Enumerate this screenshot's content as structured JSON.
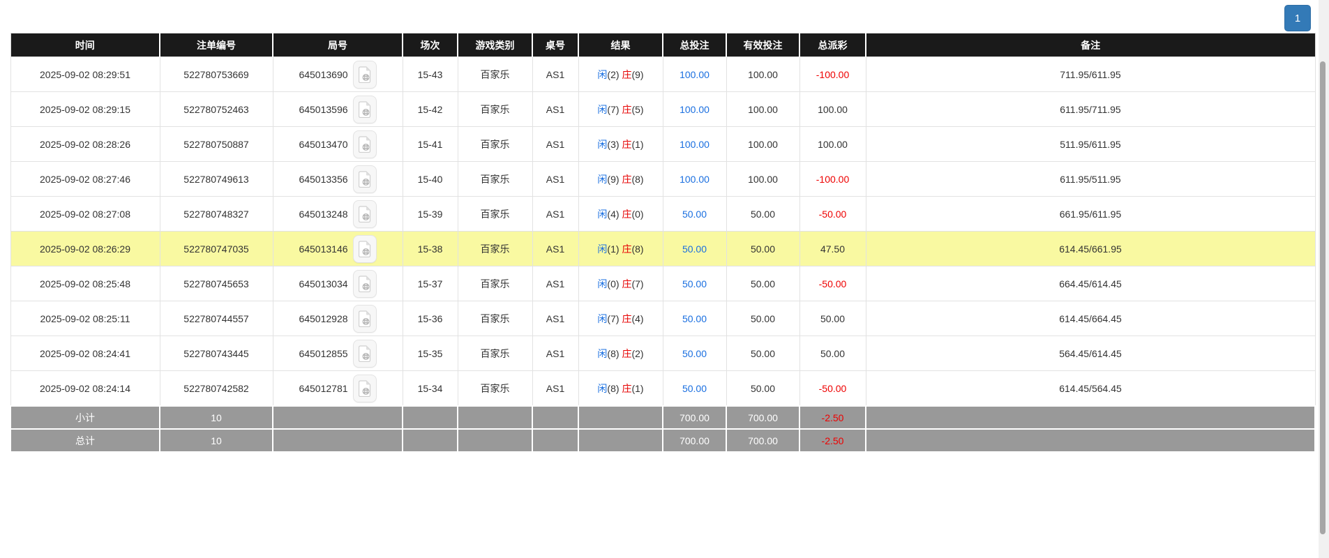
{
  "pagination": {
    "current_page": "1"
  },
  "colors": {
    "header_bg": "#1a1a1a",
    "link_blue": "#1a6fe0",
    "banker_red": "#e60000",
    "negative_red": "#ee0000",
    "highlight_yellow": "#f9f9a1",
    "summary_gray": "#999999",
    "pager_blue": "#337ab7"
  },
  "icons": {
    "round_action": "video-replay-icon"
  },
  "table": {
    "headers": [
      "时间",
      "注单编号",
      "局号",
      "场次",
      "游戏类别",
      "桌号",
      "结果",
      "总投注",
      "有效投注",
      "总派彩",
      "备注"
    ],
    "rows": [
      {
        "time": "2025-09-02 08:29:51",
        "bet_no": "522780753669",
        "round_no": "645013690",
        "session": "15-43",
        "game": "百家乐",
        "table_no": "AS1",
        "player_label": "闲",
        "player_score": "(2)",
        "banker_label": "庄",
        "banker_score": "(9)",
        "total_bet": "100.00",
        "valid_bet": "100.00",
        "payout": "-100.00",
        "remark": "711.95/611.95",
        "highlight": false
      },
      {
        "time": "2025-09-02 08:29:15",
        "bet_no": "522780752463",
        "round_no": "645013596",
        "session": "15-42",
        "game": "百家乐",
        "table_no": "AS1",
        "player_label": "闲",
        "player_score": "(7)",
        "banker_label": "庄",
        "banker_score": "(5)",
        "total_bet": "100.00",
        "valid_bet": "100.00",
        "payout": "100.00",
        "remark": "611.95/711.95",
        "highlight": false
      },
      {
        "time": "2025-09-02 08:28:26",
        "bet_no": "522780750887",
        "round_no": "645013470",
        "session": "15-41",
        "game": "百家乐",
        "table_no": "AS1",
        "player_label": "闲",
        "player_score": "(3)",
        "banker_label": "庄",
        "banker_score": "(1)",
        "total_bet": "100.00",
        "valid_bet": "100.00",
        "payout": "100.00",
        "remark": "511.95/611.95",
        "highlight": false
      },
      {
        "time": "2025-09-02 08:27:46",
        "bet_no": "522780749613",
        "round_no": "645013356",
        "session": "15-40",
        "game": "百家乐",
        "table_no": "AS1",
        "player_label": "闲",
        "player_score": "(9)",
        "banker_label": "庄",
        "banker_score": "(8)",
        "total_bet": "100.00",
        "valid_bet": "100.00",
        "payout": "-100.00",
        "remark": "611.95/511.95",
        "highlight": false
      },
      {
        "time": "2025-09-02 08:27:08",
        "bet_no": "522780748327",
        "round_no": "645013248",
        "session": "15-39",
        "game": "百家乐",
        "table_no": "AS1",
        "player_label": "闲",
        "player_score": "(4)",
        "banker_label": "庄",
        "banker_score": "(0)",
        "total_bet": "50.00",
        "valid_bet": "50.00",
        "payout": "-50.00",
        "remark": "661.95/611.95",
        "highlight": false
      },
      {
        "time": "2025-09-02 08:26:29",
        "bet_no": "522780747035",
        "round_no": "645013146",
        "session": "15-38",
        "game": "百家乐",
        "table_no": "AS1",
        "player_label": "闲",
        "player_score": "(1)",
        "banker_label": "庄",
        "banker_score": "(8)",
        "total_bet": "50.00",
        "valid_bet": "50.00",
        "payout": "47.50",
        "remark": "614.45/661.95",
        "highlight": true
      },
      {
        "time": "2025-09-02 08:25:48",
        "bet_no": "522780745653",
        "round_no": "645013034",
        "session": "15-37",
        "game": "百家乐",
        "table_no": "AS1",
        "player_label": "闲",
        "player_score": "(0)",
        "banker_label": "庄",
        "banker_score": "(7)",
        "total_bet": "50.00",
        "valid_bet": "50.00",
        "payout": "-50.00",
        "remark": "664.45/614.45",
        "highlight": false
      },
      {
        "time": "2025-09-02 08:25:11",
        "bet_no": "522780744557",
        "round_no": "645012928",
        "session": "15-36",
        "game": "百家乐",
        "table_no": "AS1",
        "player_label": "闲",
        "player_score": "(7)",
        "banker_label": "庄",
        "banker_score": "(4)",
        "total_bet": "50.00",
        "valid_bet": "50.00",
        "payout": "50.00",
        "remark": "614.45/664.45",
        "highlight": false
      },
      {
        "time": "2025-09-02 08:24:41",
        "bet_no": "522780743445",
        "round_no": "645012855",
        "session": "15-35",
        "game": "百家乐",
        "table_no": "AS1",
        "player_label": "闲",
        "player_score": "(8)",
        "banker_label": "庄",
        "banker_score": "(2)",
        "total_bet": "50.00",
        "valid_bet": "50.00",
        "payout": "50.00",
        "remark": "564.45/614.45",
        "highlight": false
      },
      {
        "time": "2025-09-02 08:24:14",
        "bet_no": "522780742582",
        "round_no": "645012781",
        "session": "15-34",
        "game": "百家乐",
        "table_no": "AS1",
        "player_label": "闲",
        "player_score": "(8)",
        "banker_label": "庄",
        "banker_score": "(1)",
        "total_bet": "50.00",
        "valid_bet": "50.00",
        "payout": "-50.00",
        "remark": "614.45/564.45",
        "highlight": false
      }
    ],
    "subtotal": {
      "label": "小计",
      "count": "10",
      "total_bet": "700.00",
      "valid_bet": "700.00",
      "payout": "-2.50"
    },
    "total": {
      "label": "总计",
      "count": "10",
      "total_bet": "700.00",
      "valid_bet": "700.00",
      "payout": "-2.50"
    }
  }
}
